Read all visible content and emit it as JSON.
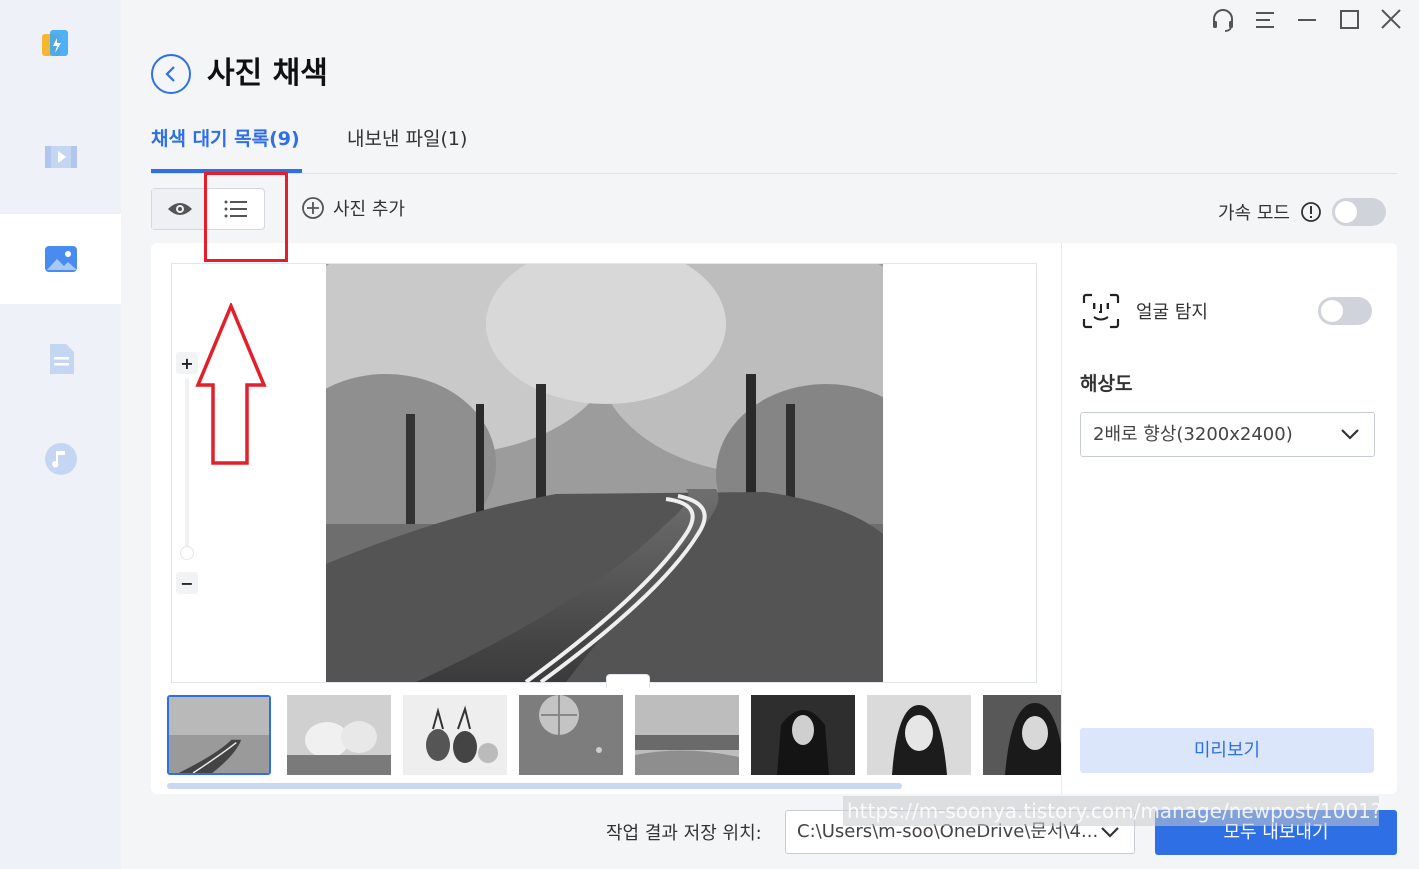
{
  "window": {
    "controls": [
      "headset-icon",
      "menu-icon",
      "minimize-icon",
      "maximize-icon",
      "close-icon"
    ]
  },
  "sidebar": {
    "items": [
      {
        "name": "video",
        "icon": "video-icon",
        "active": false
      },
      {
        "name": "photo",
        "icon": "image-icon",
        "active": true
      },
      {
        "name": "document",
        "icon": "document-icon",
        "active": false
      },
      {
        "name": "audio",
        "icon": "music-icon",
        "active": false
      }
    ]
  },
  "header": {
    "title": "사진 채색"
  },
  "tabs": [
    {
      "label": "채색 대기 목록(9)",
      "active": true
    },
    {
      "label": "내보낸 파일(1)",
      "active": false
    }
  ],
  "toolbar": {
    "add_photo_label": "사진 추가",
    "accel_label": "가속 모드",
    "accel_enabled": false
  },
  "preview": {
    "zoom_plus": "+",
    "zoom_minus": "−"
  },
  "thumbnails": [
    {
      "name": "forest-road",
      "selected": true
    },
    {
      "name": "bubble-house",
      "selected": false
    },
    {
      "name": "pineapples",
      "selected": false
    },
    {
      "name": "hot-air-balloon",
      "selected": false
    },
    {
      "name": "landscape",
      "selected": false
    },
    {
      "name": "portrait-1",
      "selected": false
    },
    {
      "name": "portrait-2",
      "selected": false
    },
    {
      "name": "portrait-3",
      "selected": false
    }
  ],
  "settings": {
    "face_label": "얼굴 탐지",
    "face_enabled": false,
    "resolution_title": "해상도",
    "resolution_value": "2배로 향상(3200x2400)",
    "preview_button": "미리보기"
  },
  "footer": {
    "save_label": "작업 결과 저장 위치:",
    "save_path": "C:\\Users\\m-soo\\OneDrive\\문서\\4...",
    "export_button": "모두 내보내기",
    "url_overlay": "https://m-soonya.tistory.com/manage/newpost/1001?"
  },
  "colors": {
    "accent": "#2f6fe6",
    "annotation": "#e3202a"
  }
}
